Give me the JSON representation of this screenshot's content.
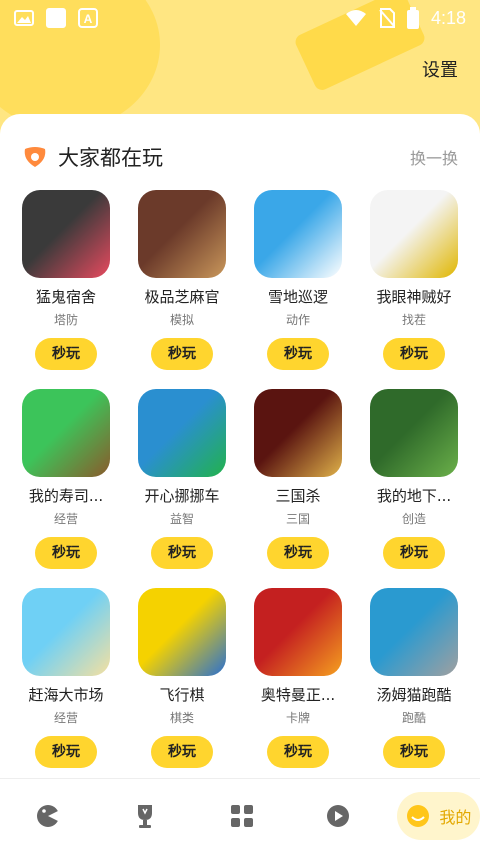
{
  "status_bar": {
    "time": "4:18"
  },
  "header": {
    "settings_label": "设置"
  },
  "section": {
    "title": "大家都在玩",
    "refresh_label": "换一换"
  },
  "play_label": "秒玩",
  "games": [
    {
      "name": "猛鬼宿舍",
      "tag": "塔防",
      "colors": [
        "#3a3a3a",
        "#e84a5f"
      ]
    },
    {
      "name": "极品芝麻官",
      "tag": "模拟",
      "colors": [
        "#6b3a2a",
        "#c9975b"
      ]
    },
    {
      "name": "雪地巡逻",
      "tag": "动作",
      "colors": [
        "#3aa7e8",
        "#ffffff"
      ]
    },
    {
      "name": "我眼神贼好",
      "tag": "找茬",
      "colors": [
        "#f4f4f4",
        "#e0b600"
      ]
    },
    {
      "name": "我的寿司...",
      "tag": "经营",
      "colors": [
        "#3cc45a",
        "#8b5a2b"
      ]
    },
    {
      "name": "开心挪挪车",
      "tag": "益智",
      "colors": [
        "#2a8fd0",
        "#22b24c"
      ]
    },
    {
      "name": "三国杀",
      "tag": "三国",
      "colors": [
        "#5a1410",
        "#e0b24a"
      ]
    },
    {
      "name": "我的地下...",
      "tag": "创造",
      "colors": [
        "#2f6a2a",
        "#6bb04a"
      ]
    },
    {
      "name": "赶海大市场",
      "tag": "经营",
      "colors": [
        "#6fd0f5",
        "#f5e0a0"
      ]
    },
    {
      "name": "飞行棋",
      "tag": "棋类",
      "colors": [
        "#f5d200",
        "#2a6fd0"
      ]
    },
    {
      "name": "奥特曼正...",
      "tag": "卡牌",
      "colors": [
        "#c42020",
        "#f5a020"
      ]
    },
    {
      "name": "汤姆猫跑酷",
      "tag": "跑酷",
      "colors": [
        "#2a9ad0",
        "#a0a0a0"
      ]
    }
  ],
  "tabbar": {
    "items": [
      {
        "icon": "game-face-icon"
      },
      {
        "icon": "trophy-icon"
      },
      {
        "icon": "category-grid-icon"
      },
      {
        "icon": "video-play-icon"
      },
      {
        "icon": "smile-face-icon",
        "label": "我的"
      }
    ]
  },
  "colors": {
    "accent": "#ffd52e",
    "header_bg": "#ffe682"
  }
}
